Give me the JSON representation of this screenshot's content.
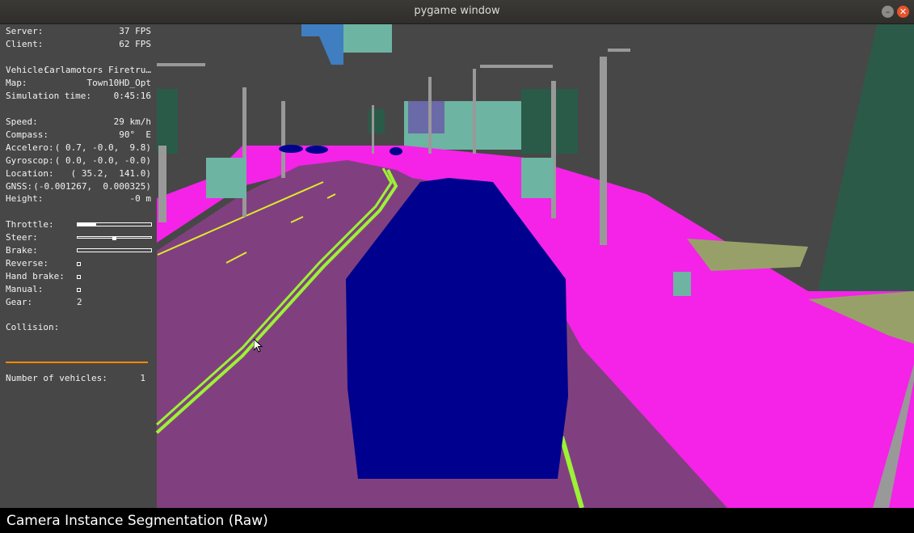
{
  "window": {
    "title": "pygame window",
    "minimize_icon": "minimize-icon",
    "close_icon": "close-icon"
  },
  "hud": {
    "server": {
      "label": "Server:",
      "value": "37 FPS"
    },
    "client": {
      "label": "Client:",
      "value": "62 FPS"
    },
    "vehicle": {
      "label": "Vehicle:",
      "value": "Carlamotors Firetru…"
    },
    "map": {
      "label": "Map:",
      "value": "Town10HD_Opt"
    },
    "sim_time": {
      "label": "Simulation time:",
      "value": "0:45:16"
    },
    "speed": {
      "label": "Speed:",
      "value": "29 km/h"
    },
    "compass": {
      "label": "Compass:",
      "value": "90°  E"
    },
    "accelero": {
      "label": "Accelero:",
      "value": "( 0.7, -0.0,  9.8)"
    },
    "gyroscop": {
      "label": "Gyroscop:",
      "value": "( 0.0, -0.0, -0.0)"
    },
    "location": {
      "label": "Location:",
      "value": "( 35.2,  141.0)"
    },
    "gnss": {
      "label": "GNSS:",
      "value": "(-0.001267,  0.000325)"
    },
    "height": {
      "label": "Height:",
      "value": "-0 m"
    },
    "throttle": {
      "label": "Throttle:",
      "level": 0.25
    },
    "steer": {
      "label": "Steer:",
      "level": 0.0
    },
    "brake": {
      "label": "Brake:",
      "level": 0.0
    },
    "reverse": {
      "label": "Reverse:",
      "checked": false
    },
    "hand_brake": {
      "label": "Hand brake:",
      "checked": false
    },
    "manual": {
      "label": "Manual:",
      "checked": false
    },
    "gear": {
      "label": "Gear:",
      "value": "2"
    },
    "collision": {
      "label": "Collision:"
    },
    "num_vehicles": {
      "label": "Number of vehicles:",
      "value": "1"
    }
  },
  "caption": "Camera Instance Segmentation (Raw)",
  "colors": {
    "sky": "#474747",
    "road": "#80407f",
    "sidewalk": "#f423e7",
    "vehicle": "#00008e",
    "lane_marking": "#9cf235",
    "pole": "#999999",
    "building": "#46826e",
    "terrain": "#98a069",
    "static": "#6eb4a2",
    "collision_line": "#ff8800"
  }
}
